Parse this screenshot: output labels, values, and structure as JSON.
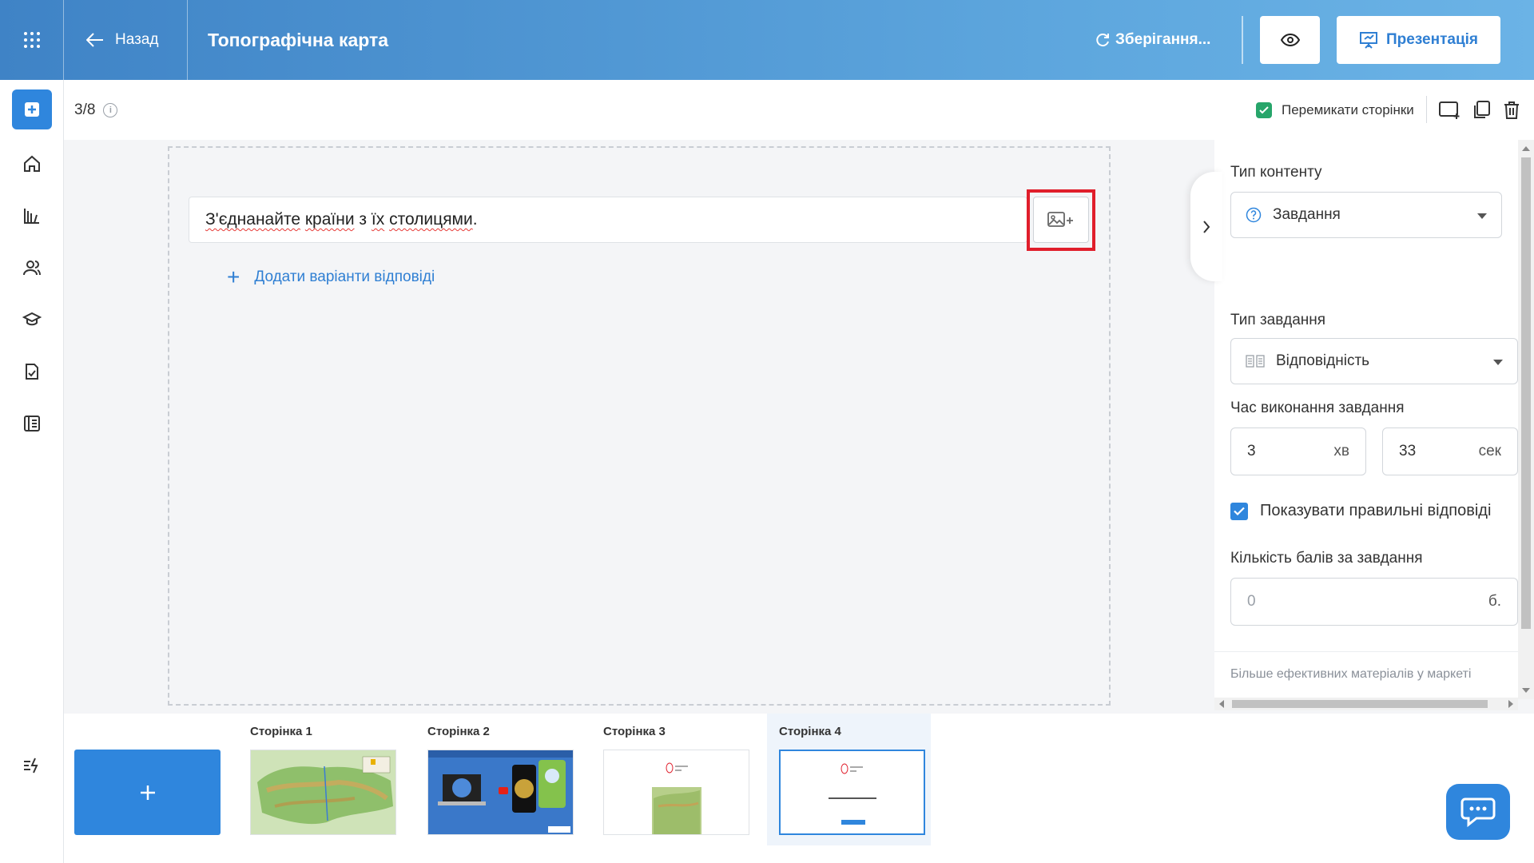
{
  "header": {
    "back_label": "Назад",
    "title": "Топографічна карта",
    "saving_label": "Зберігання...",
    "present_label": "Презентація"
  },
  "subbar": {
    "page_counter": "3/8",
    "switch_pages_label": "Перемикати сторінки",
    "switch_pages_checked": true
  },
  "editor": {
    "question_parts": [
      "З'єднанайте",
      " ",
      "країни",
      " з ",
      "їх",
      " ",
      "столицями",
      "."
    ],
    "add_answers_label": "Додати варіанти відповіді"
  },
  "panel": {
    "content_type_label": "Тип контенту",
    "content_type_value": "Завдання",
    "task_type_label": "Тип завдання",
    "task_type_value": "Відповідність",
    "time_label": "Час виконання завдання",
    "minutes_value": "3",
    "minutes_unit": "хв",
    "seconds_value": "33",
    "seconds_unit": "сек",
    "show_correct_label": "Показувати правильні відповіді",
    "show_correct_checked": true,
    "points_label": "Кількість балів за завдання",
    "points_placeholder": "0",
    "points_unit": "б.",
    "market_text": "Більше ефективних матеріалів у маркеті"
  },
  "pages": [
    {
      "label": "Сторінка 1",
      "thumb": "ukraine-map"
    },
    {
      "label": "Сторінка 2",
      "thumb": "devices-slide"
    },
    {
      "label": "Сторінка 3",
      "thumb": "map-task"
    },
    {
      "label": "Сторінка 4",
      "thumb": "text-task",
      "active": true
    }
  ],
  "icons": {
    "apps": "grid-icon",
    "back": "arrow-left-icon",
    "saving": "refresh-icon",
    "preview": "eye-icon",
    "present": "presentation-icon"
  },
  "colors": {
    "accent": "#2f86dd",
    "header_start": "#3f83c6",
    "header_end": "#6bb3e6",
    "switch_green": "#27a56a",
    "highlight_red": "#e01e2b"
  }
}
